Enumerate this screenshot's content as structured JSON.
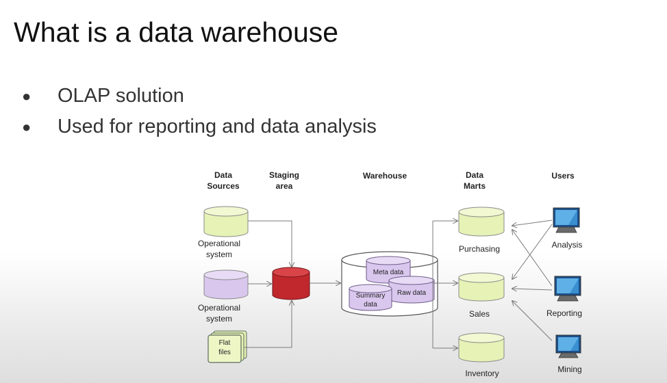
{
  "slide": {
    "title": "What is a data warehouse",
    "bullets": [
      "OLAP solution",
      "Used for reporting and data analysis"
    ]
  },
  "diagram": {
    "headers": {
      "data_sources": [
        "Data",
        "Sources"
      ],
      "staging": [
        "Staging",
        "area"
      ],
      "warehouse": "Warehouse",
      "data_marts": [
        "Data",
        "Marts"
      ],
      "users": "Users"
    },
    "sources": [
      {
        "lines": [
          "Operational",
          "system"
        ]
      },
      {
        "lines": [
          "Operational",
          "system"
        ]
      },
      {
        "lines": [
          "Flat",
          "files"
        ]
      }
    ],
    "warehouse_parts": {
      "meta": "Meta data",
      "raw": "Raw data",
      "summary": [
        "Summary",
        "data"
      ]
    },
    "marts": [
      "Purchasing",
      "Sales",
      "Inventory"
    ],
    "users": [
      "Analysis",
      "Reporting",
      "Mining"
    ],
    "colors": {
      "source1": "#e6f2b6",
      "source2": "#d9c7ee",
      "staging": "#c0282d",
      "warehouse_db": "#d9c7ee",
      "mart": "#e6f2b6",
      "monitor": "#3a8fd0"
    }
  }
}
